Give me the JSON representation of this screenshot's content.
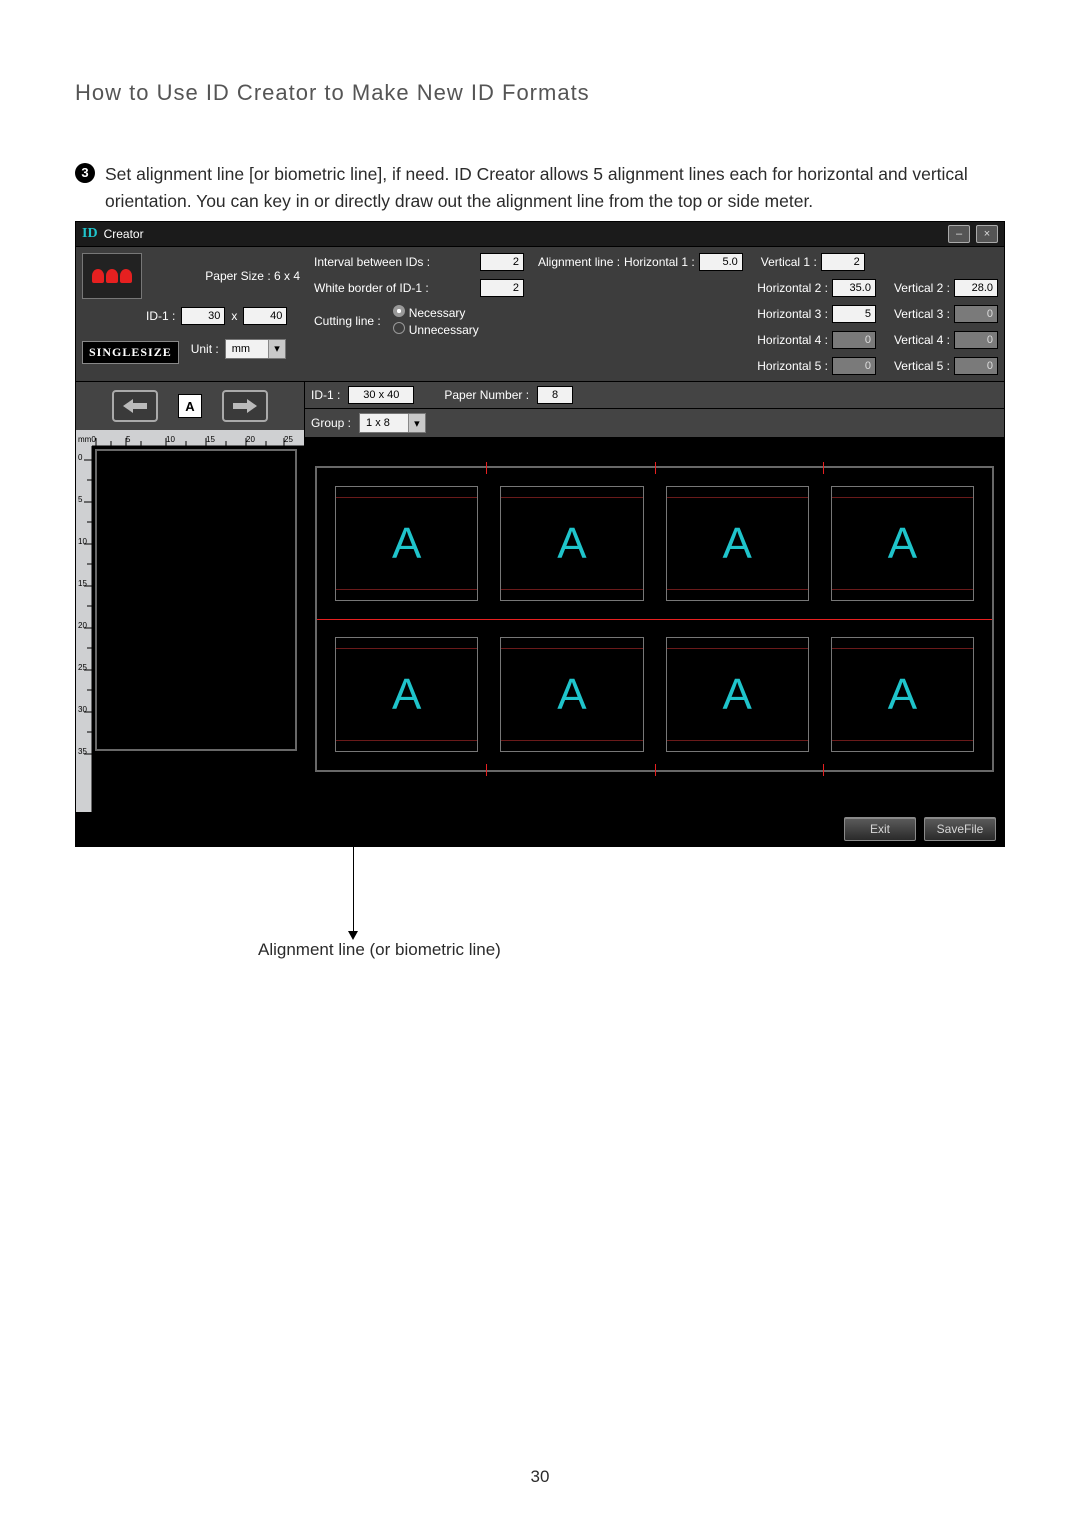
{
  "doc": {
    "page_title": "How to Use ID Creator to Make New ID Formats",
    "step_number": "3",
    "step_text": "Set alignment line [or biometric line], if need.   ID Creator allows 5 alignment lines each for horizontal and vertical orientation.   You can key in or directly draw out the alignment line from the top or side meter.",
    "callout": "Alignment line (or biometric line)",
    "page_number": "30"
  },
  "app": {
    "title": "Creator",
    "logo_left": "ID",
    "top_left": {
      "paper_size_label": "Paper Size : 6 x 4",
      "id1_label": "ID-1 :",
      "id1_w": "30",
      "id1_x": "x",
      "id1_h": "40",
      "single_size": "SINGLESIZE",
      "unit_label": "Unit :",
      "unit_value": "mm"
    },
    "middle": {
      "interval_label": "Interval between IDs :",
      "interval_val": "2",
      "border_label": "White border of ID-1 :",
      "border_val": "2",
      "cutting_label": "Cutting line :",
      "necessary": "Necessary",
      "unnecessary": "Unnecessary"
    },
    "align": {
      "header": "Alignment line :",
      "h_labels": [
        "Horizontal 1 :",
        "Horizontal 2 :",
        "Horizontal 3 :",
        "Horizontal 4 :",
        "Horizontal 5 :"
      ],
      "h_vals": [
        "5.0",
        "35.0",
        "5",
        "0",
        "0"
      ],
      "v_labels": [
        "Vertical 1 :",
        "Vertical 2 :",
        "Vertical 3 :",
        "Vertical 4 :",
        "Vertical 5 :"
      ],
      "v_vals": [
        "2",
        "28.0",
        "0",
        "0",
        "0"
      ]
    },
    "leftpane": {
      "letter": "A",
      "ruler_top": [
        "mm0",
        "5",
        "10",
        "15",
        "20",
        "25"
      ],
      "ruler_side": [
        "0",
        "5",
        "10",
        "15",
        "20",
        "25",
        "30",
        "35"
      ]
    },
    "rightstrip": {
      "id_label": "ID-1  :",
      "id_size": "30 x 40",
      "paper_label": "Paper Number :",
      "paper_val": "8",
      "group_label": "Group :",
      "group_val": "1 x 8"
    },
    "grid_letter": "A",
    "buttons": {
      "exit": "Exit",
      "save": "SaveFile"
    }
  }
}
